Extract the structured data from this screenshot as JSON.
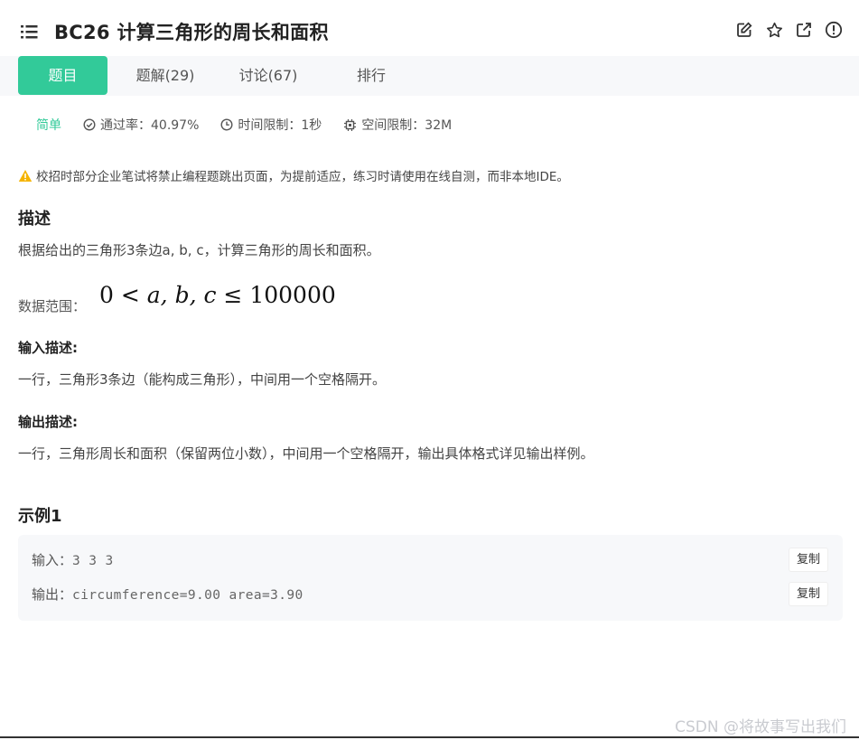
{
  "header": {
    "title": "BC26  计算三角形的周长和面积",
    "icons": [
      "edit-icon",
      "star-icon",
      "share-icon",
      "report-icon"
    ]
  },
  "tabs": [
    {
      "label": "题目",
      "active": true
    },
    {
      "label": "题解(29)",
      "active": false
    },
    {
      "label": "讨论(67)",
      "active": false
    },
    {
      "label": "排行",
      "active": false
    }
  ],
  "meta": {
    "difficulty": "简单",
    "pass_rate": "通过率：40.97%",
    "time_limit": "时间限制：1秒",
    "space_limit": "空间限制：32M"
  },
  "notice": "校招时部分企业笔试将禁止编程题跳出页面，为提前适应，练习时请使用在线自测，而非本地IDE。",
  "description": {
    "heading": "描述",
    "text": "根据给出的三角形3条边a, b, c，计算三角形的周长和面积。",
    "range_label": "数据范围：",
    "range_math": {
      "lhs": "0 <",
      "vars": "a, b, c",
      "op": "≤",
      "rhs": "100000"
    }
  },
  "input_desc": {
    "heading": "输入描述:",
    "text": "一行，三角形3条边（能构成三角形），中间用一个空格隔开。"
  },
  "output_desc": {
    "heading": "输出描述:",
    "text": "一行，三角形周长和面积（保留两位小数），中间用一个空格隔开，输出具体格式详见输出样例。"
  },
  "example": {
    "heading": "示例1",
    "input_label": "输入：",
    "input_value": "3 3 3",
    "output_label": "输出：",
    "output_value": "circumference=9.00 area=3.90",
    "copy_label": "复制"
  },
  "watermark": "CSDN @将故事写出我们",
  "colors": {
    "accent": "#32ca99",
    "warning": "#f5b400",
    "tabbar_bg": "#f7f8fa"
  }
}
